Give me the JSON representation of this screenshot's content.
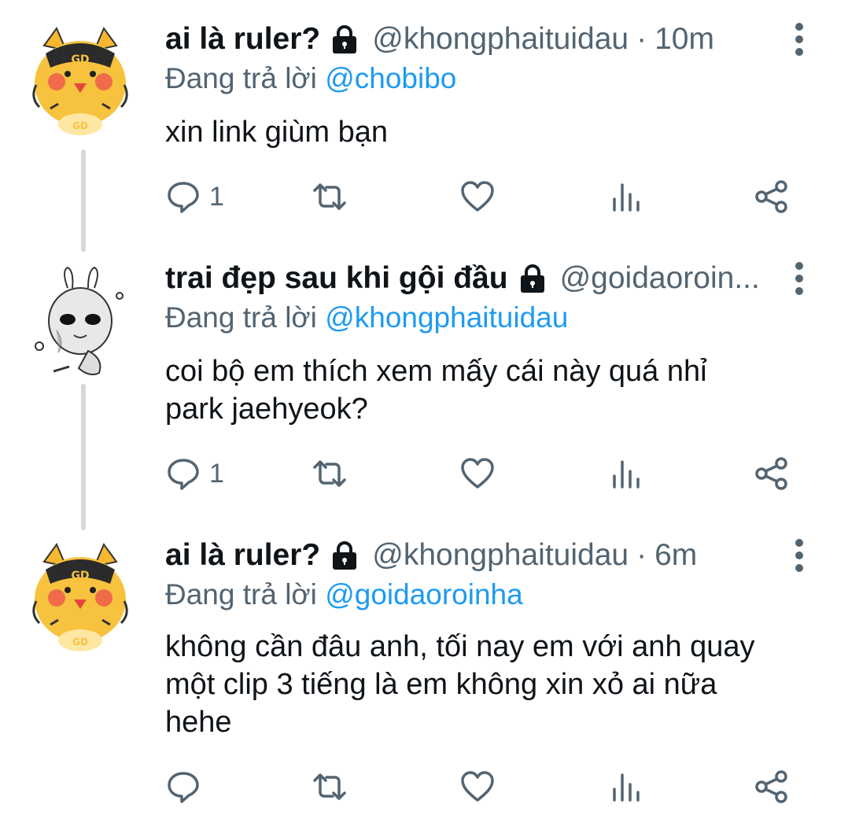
{
  "tweets": [
    {
      "display_name": "ai là ruler?",
      "handle": "@khongphaituidau",
      "separator": "·",
      "time": "10m",
      "replying_prefix": "Đang trả lời",
      "replying_to": "@chobibo",
      "text": "xin link giùm bạn",
      "reply_count": "1",
      "avatar": "orange-cat-avatar"
    },
    {
      "display_name": "trai đẹp sau khi gội đầu",
      "handle": "@goidaoroin...",
      "separator": "",
      "time": "",
      "replying_prefix": "Đang trả lời",
      "replying_to": "@khongphaituidau",
      "text_lines": [
        "coi bộ em thích xem mấy cái này quá nhỉ",
        "park jaehyeok?"
      ],
      "reply_count": "1",
      "avatar": "white-bunny-avatar"
    },
    {
      "display_name": "ai là ruler?",
      "handle": "@khongphaituidau",
      "separator": "·",
      "time": "6m",
      "replying_prefix": "Đang trả lời",
      "replying_to": "@goidaoroinha",
      "text_lines": [
        "không cần đâu anh, tối nay em với anh quay",
        "một clip 3 tiếng là em không xin xỏ ai nữa",
        "hehe"
      ],
      "reply_count": "",
      "avatar": "orange-cat-avatar"
    }
  ],
  "colors": {
    "text": "#0f1419",
    "muted": "#536471",
    "link": "#1d9bf0",
    "thread_line": "#d7d7d7"
  },
  "icons": [
    "lock-icon",
    "more-vertical-icon",
    "reply-icon",
    "retweet-icon",
    "like-icon",
    "views-icon",
    "share-icon"
  ]
}
